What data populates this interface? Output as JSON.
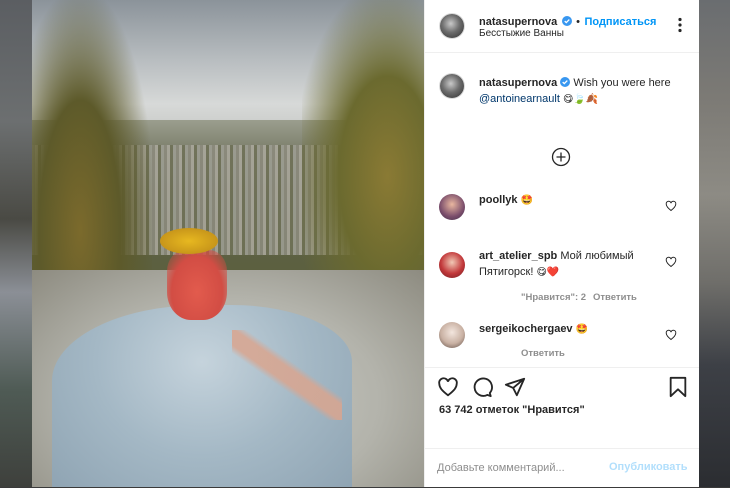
{
  "post": {
    "author": "natasupernova",
    "dot": "•",
    "follow_label": "Подписаться",
    "location": "Бесстыжие Ванны",
    "caption_author": "natasupernova",
    "caption_text": "Wish you were here",
    "caption_mention": "@antoinearnault",
    "caption_emojis": "😋🍃🍂"
  },
  "comments": [
    {
      "author": "poollyk",
      "text": "🤩",
      "emoji_only": true
    },
    {
      "author": "art_atelier_spb",
      "text": "Мой любимый Пятигорск!",
      "emojis": "😋❤️",
      "likes_label": "\"Нравится\": 2",
      "reply_label": "Ответить"
    },
    {
      "author": "sergeikochergaev",
      "text": "🤩",
      "reply_label": "Ответить"
    }
  ],
  "actions": {
    "likes_text": "63 742 отметок \"Нравится\""
  },
  "add_comment": {
    "placeholder": "Добавьте комментарий...",
    "publish_label": "Опубликовать"
  },
  "colors": {
    "accent": "#0095f6",
    "mention": "#00376b",
    "publish_disabled": "#b2dffc",
    "muted": "#8e8e8e"
  },
  "icons": [
    "verified-badge-icon",
    "more-options-icon",
    "add-circle-icon",
    "heart-icon",
    "comment-icon",
    "share-icon",
    "bookmark-icon"
  ]
}
